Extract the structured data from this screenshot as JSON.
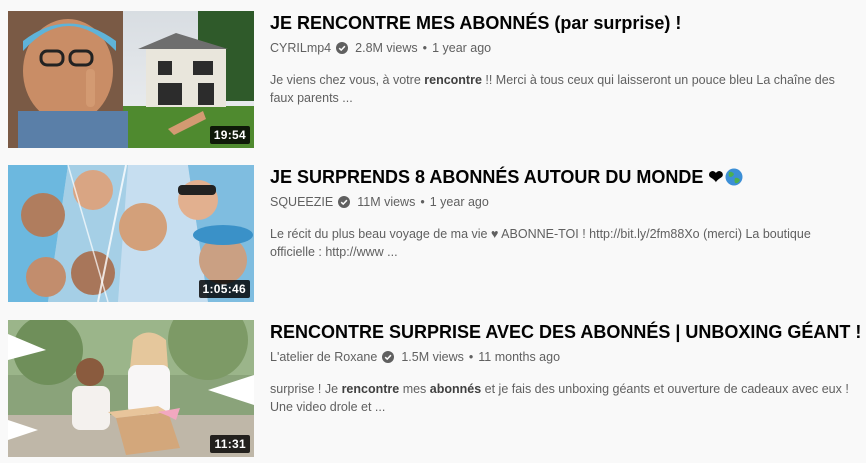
{
  "results": [
    {
      "title": "JE RENCONTRE MES ABONNÉS (par surprise) !",
      "channel": "CYRILmp4",
      "views": "2.8M views",
      "age": "1 year ago",
      "duration": "19:54",
      "desc_1": "Je viens chez vous, à votre ",
      "desc_bold": "rencontre",
      "desc_2": " !! Merci à tous ceux qui laisseront un pouce bleu La chaîne des faux parents ..."
    },
    {
      "title": "JE SURPRENDS 8 ABONNÉS AUTOUR DU MONDE ❤",
      "title_icon": "globe-emoji-icon",
      "channel": "SQUEEZIE",
      "views": "11M views",
      "age": "1 year ago",
      "duration": "1:05:46",
      "desc": "Le récit du plus beau voyage de ma vie ♥ ABONNE-TOI ! http://bit.ly/2fm88Xo (merci) La boutique officielle : http://www ..."
    },
    {
      "title": "RENCONTRE SURPRISE AVEC DES ABONNÉS | UNBOXING GÉANT !",
      "channel": "L'atelier de Roxane",
      "views": "1.5M views",
      "age": "11 months ago",
      "duration": "11:31",
      "desc_1": "surprise ! Je ",
      "desc_bold_1": "rencontre",
      "desc_2": " mes ",
      "desc_bold_2": "abonnés",
      "desc_3": " et je fais des unboxing géants et ouverture de cadeaux avec eux ! Une video drole et ..."
    }
  ],
  "separator": "•",
  "verified_icon": "verified-check-icon"
}
